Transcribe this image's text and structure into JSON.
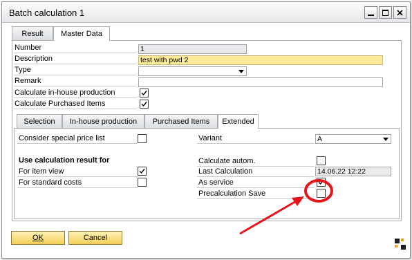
{
  "window": {
    "title": "Batch calculation 1"
  },
  "top_tabs": [
    {
      "label": "Result"
    },
    {
      "label": "Master Data"
    }
  ],
  "header": {
    "number_label": "Number",
    "number_value": "1",
    "description_label": "Description",
    "description_value": "test with pwd 2",
    "type_label": "Type",
    "type_value": "",
    "remark_label": "Remark",
    "remark_value": "",
    "calc_inhouse_label": "Calculate in-house production",
    "calc_inhouse_checked": true,
    "calc_purchased_label": "Calculate Purchased Items",
    "calc_purchased_checked": true
  },
  "inner_tabs": [
    {
      "label": "Selection"
    },
    {
      "label": "In-house production"
    },
    {
      "label": "Purchased Items"
    },
    {
      "label": "Extended"
    }
  ],
  "extended": {
    "special_price_label": "Consider special price list",
    "special_price_checked": false,
    "use_calc_heading": "Use calculation result for",
    "item_view_label": "For item view",
    "item_view_checked": true,
    "standard_costs_label": "For standard costs",
    "standard_costs_checked": false,
    "variant_label": "Variant",
    "variant_value": "A",
    "calc_autom_label": "Calculate autom.",
    "calc_autom_checked": false,
    "last_calc_label": "Last Calculation",
    "last_calc_value": "14.06.22 12:22",
    "as_service_label": "As service",
    "as_service_checked": true,
    "precalc_save_label": "Precalculation Save",
    "precalc_save_checked": false
  },
  "buttons": {
    "ok_label": "OK",
    "cancel_label": "Cancel"
  },
  "colors": {
    "focus_field": "#fdeb9a",
    "button": "#f4cf55",
    "annotation": "#e8131b"
  },
  "icons": [
    "minimize-icon",
    "maximize-icon",
    "close-icon",
    "dropdown-arrow-icon",
    "checkmark-icon",
    "sap-logo-icon"
  ]
}
